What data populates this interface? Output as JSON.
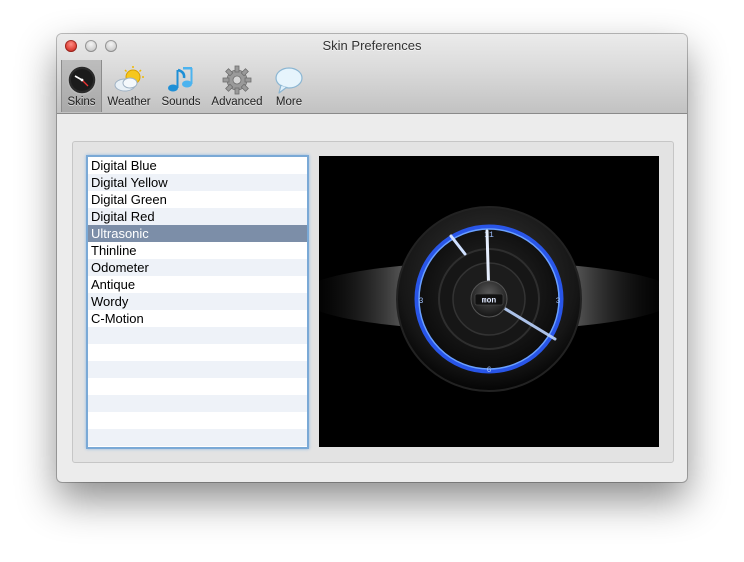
{
  "window": {
    "title": "Skin Preferences"
  },
  "toolbar": {
    "items": [
      {
        "label": "Skins",
        "icon": "clock-icon",
        "selected": true
      },
      {
        "label": "Weather",
        "icon": "weather-icon",
        "selected": false
      },
      {
        "label": "Sounds",
        "icon": "music-notes-icon",
        "selected": false
      },
      {
        "label": "Advanced",
        "icon": "gear-icon",
        "selected": false
      },
      {
        "label": "More",
        "icon": "speech-bubble-icon",
        "selected": false
      }
    ]
  },
  "skins": {
    "items": [
      "Digital Blue",
      "Digital Yellow",
      "Digital Green",
      "Digital Red",
      "Ultrasonic",
      "Thinline",
      "Odometer",
      "Antique",
      "Wordy",
      "C-Motion"
    ],
    "selected": "Ultrasonic"
  },
  "preview": {
    "day_label": "mon",
    "hour_markers": {
      "top": "11",
      "left": "3",
      "right": "3",
      "bottom": "6"
    },
    "accent_color": "#2a5cff"
  }
}
